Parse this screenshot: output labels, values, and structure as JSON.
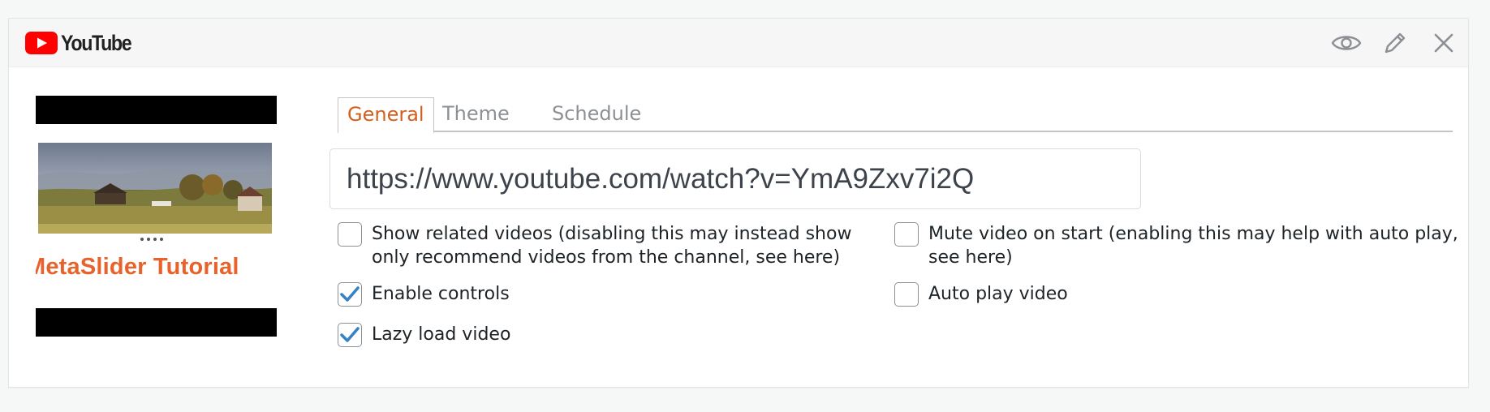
{
  "header": {
    "logo_text": "YouTube",
    "logo_color": "#ff0000",
    "actions": [
      {
        "name": "preview",
        "icon": "eye-icon"
      },
      {
        "name": "edit",
        "icon": "pencil-icon"
      },
      {
        "name": "close",
        "icon": "close-icon"
      }
    ]
  },
  "thumbnail": {
    "title_text": "MetaSlider Tutorial"
  },
  "tabs": [
    {
      "label": "General",
      "active": true
    },
    {
      "label": "Theme",
      "active": false
    },
    {
      "label": "Schedule",
      "active": false
    }
  ],
  "url_field": {
    "value": "https://www.youtube.com/watch?v=YmA9Zxv7i2Q"
  },
  "options": {
    "show_related": {
      "label": "Show related videos (disabling this may instead show only recommend videos from the channel, see here)",
      "checked": false
    },
    "mute_on_start": {
      "label": "Mute video on start (enabling this may help with auto play, see here)",
      "checked": false
    },
    "enable_controls": {
      "label": "Enable controls",
      "checked": true
    },
    "auto_play": {
      "label": "Auto play video",
      "checked": false
    },
    "lazy_load": {
      "label": "Lazy load video",
      "checked": true
    }
  },
  "colors": {
    "accent": "#d1601f",
    "checkmark": "#3582c4"
  }
}
